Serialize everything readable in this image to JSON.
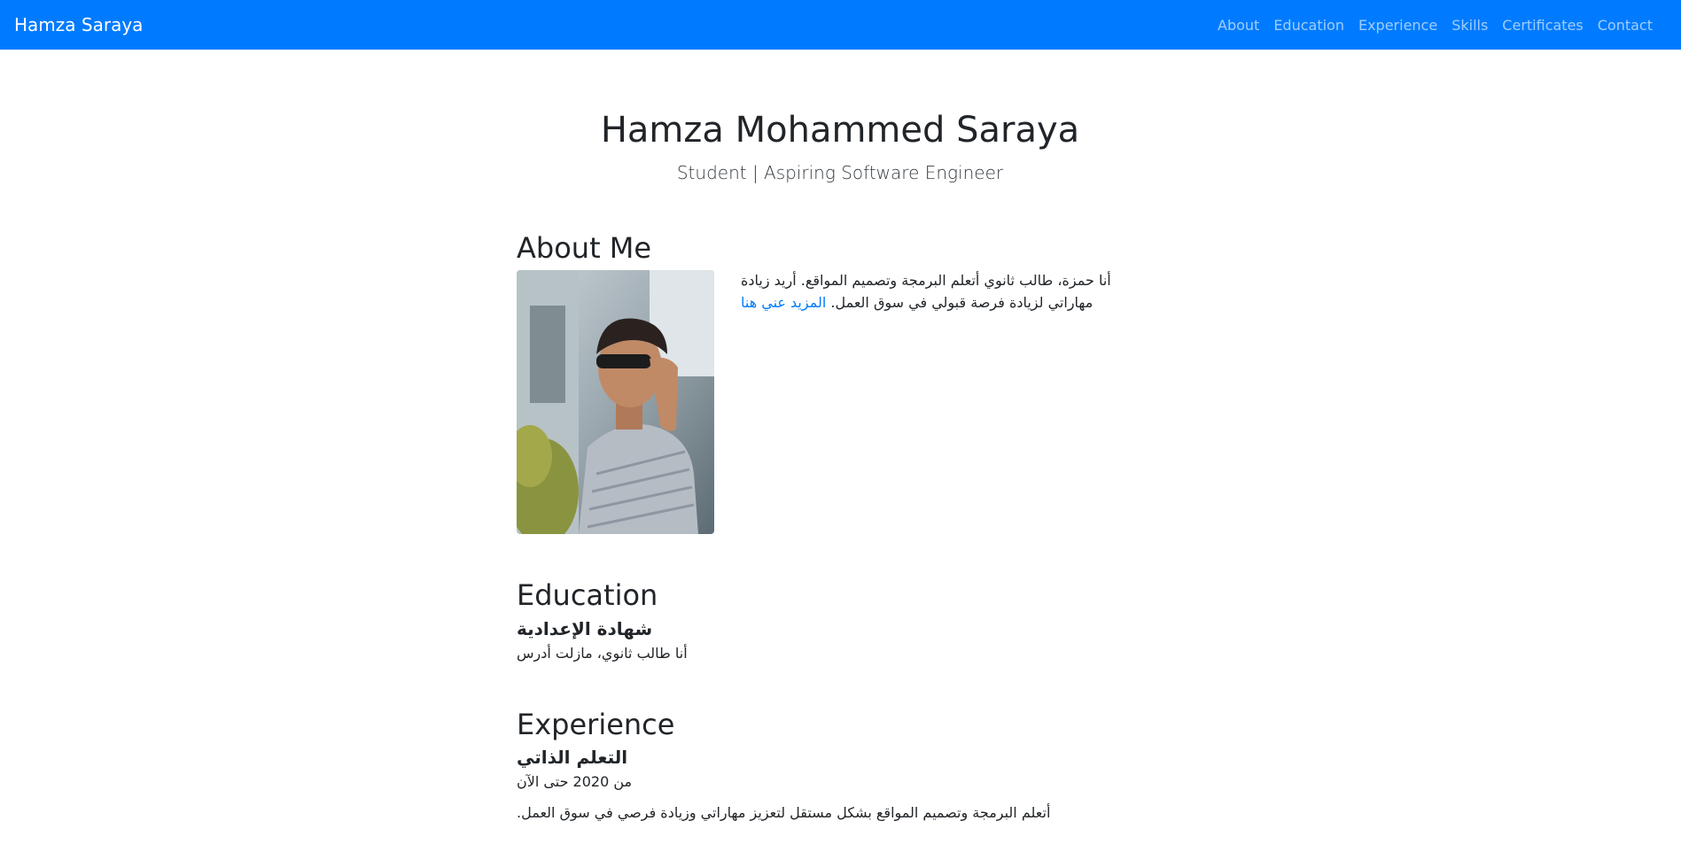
{
  "navbar": {
    "brand": "Hamza Saraya",
    "links": [
      "About",
      "Education",
      "Experience",
      "Skills",
      "Certificates",
      "Contact"
    ]
  },
  "header": {
    "name": "Hamza Mohammed Saraya",
    "tagline": "Student | Aspiring Software Engineer"
  },
  "about": {
    "title": "About Me",
    "text": "أنا حمزة، طالب ثانوي أتعلم البرمجة وتصميم المواقع. أريد زيادة مهاراتي لزيادة فرصة قبولي في سوق العمل.",
    "link_text": "المزيد عني هنا",
    "photo_icon": "profile-photo"
  },
  "education": {
    "title": "Education",
    "item_title": "شهادة الإعدادية",
    "item_text": "أنا طالب ثانوي، مازلت أدرس"
  },
  "experience": {
    "title": "Experience",
    "item_title": "التعلم الذاتي",
    "date": "من 2020 حتى الآن",
    "description": "أتعلم البرمجة وتصميم المواقع بشكل مستقل لتعزيز مهاراتي وزيادة فرصي في سوق العمل."
  },
  "colors": {
    "navbar": "#007bff",
    "link": "#007bff",
    "text": "#212529"
  }
}
